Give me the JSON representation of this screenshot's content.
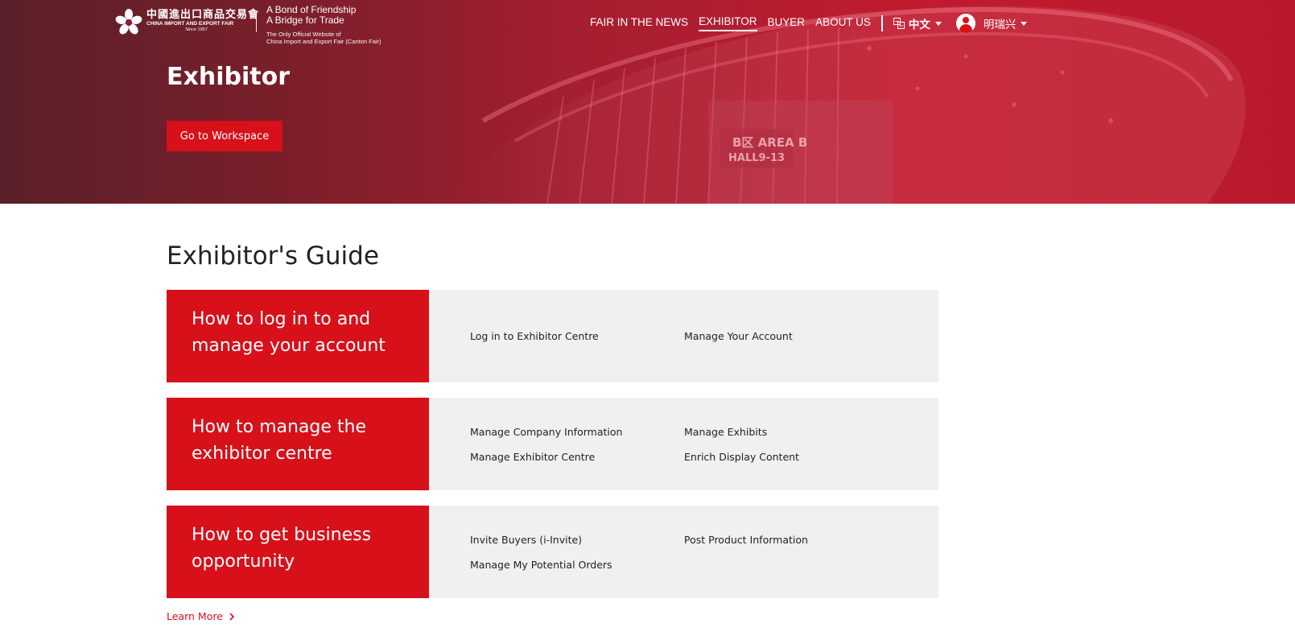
{
  "colors": {
    "brand_red": "#d7101a",
    "panel_gray": "#f0f0f0",
    "hero_gradient_start": "#5a2029",
    "hero_gradient_end": "#c01b30"
  },
  "header": {
    "logo": {
      "cn_name": "中國進出口商品交易會",
      "en_name": "CHINA IMPORT AND EXPORT FAIR",
      "since": "Since 1957",
      "slogan_line1": "A Bond of Friendship",
      "slogan_line2": "A Bridge for Trade",
      "official_line1": "The Only Official Website of",
      "official_line2": "China Import and Export Fair (Canton Fair)"
    },
    "nav": [
      {
        "label": "FAIR IN THE NEWS",
        "active": false
      },
      {
        "label": "EXHIBITOR",
        "active": true
      },
      {
        "label": "BUYER",
        "active": false
      },
      {
        "label": "ABOUT US",
        "active": false
      }
    ],
    "language": {
      "icon": "language-icon",
      "label": "中文"
    },
    "user": {
      "icon": "avatar-icon",
      "name": "明瑞兴"
    }
  },
  "hero": {
    "title": "Exhibitor",
    "workspace_button": "Go to Workspace",
    "sign_text_line1": "B区 AREA B",
    "sign_text_line2": "HALL9-13"
  },
  "guide": {
    "title": "Exhibitor's Guide",
    "sections": [
      {
        "heading_line1": "How to log in to and",
        "heading_line2": "manage your account",
        "links": [
          "Log in to Exhibitor Centre",
          "Manage Your Account"
        ]
      },
      {
        "heading_line1": "How to manage the",
        "heading_line2": "exhibitor centre",
        "links": [
          "Manage Company Information",
          "Manage Exhibits",
          "Manage Exhibitor Centre",
          "Enrich Display Content"
        ]
      },
      {
        "heading_line1": "How to get business",
        "heading_line2": "opportunity",
        "links": [
          "Invite Buyers (i-Invite)",
          "Post Product Information",
          "Manage My Potential Orders"
        ]
      }
    ],
    "learn_more": "Learn More"
  }
}
